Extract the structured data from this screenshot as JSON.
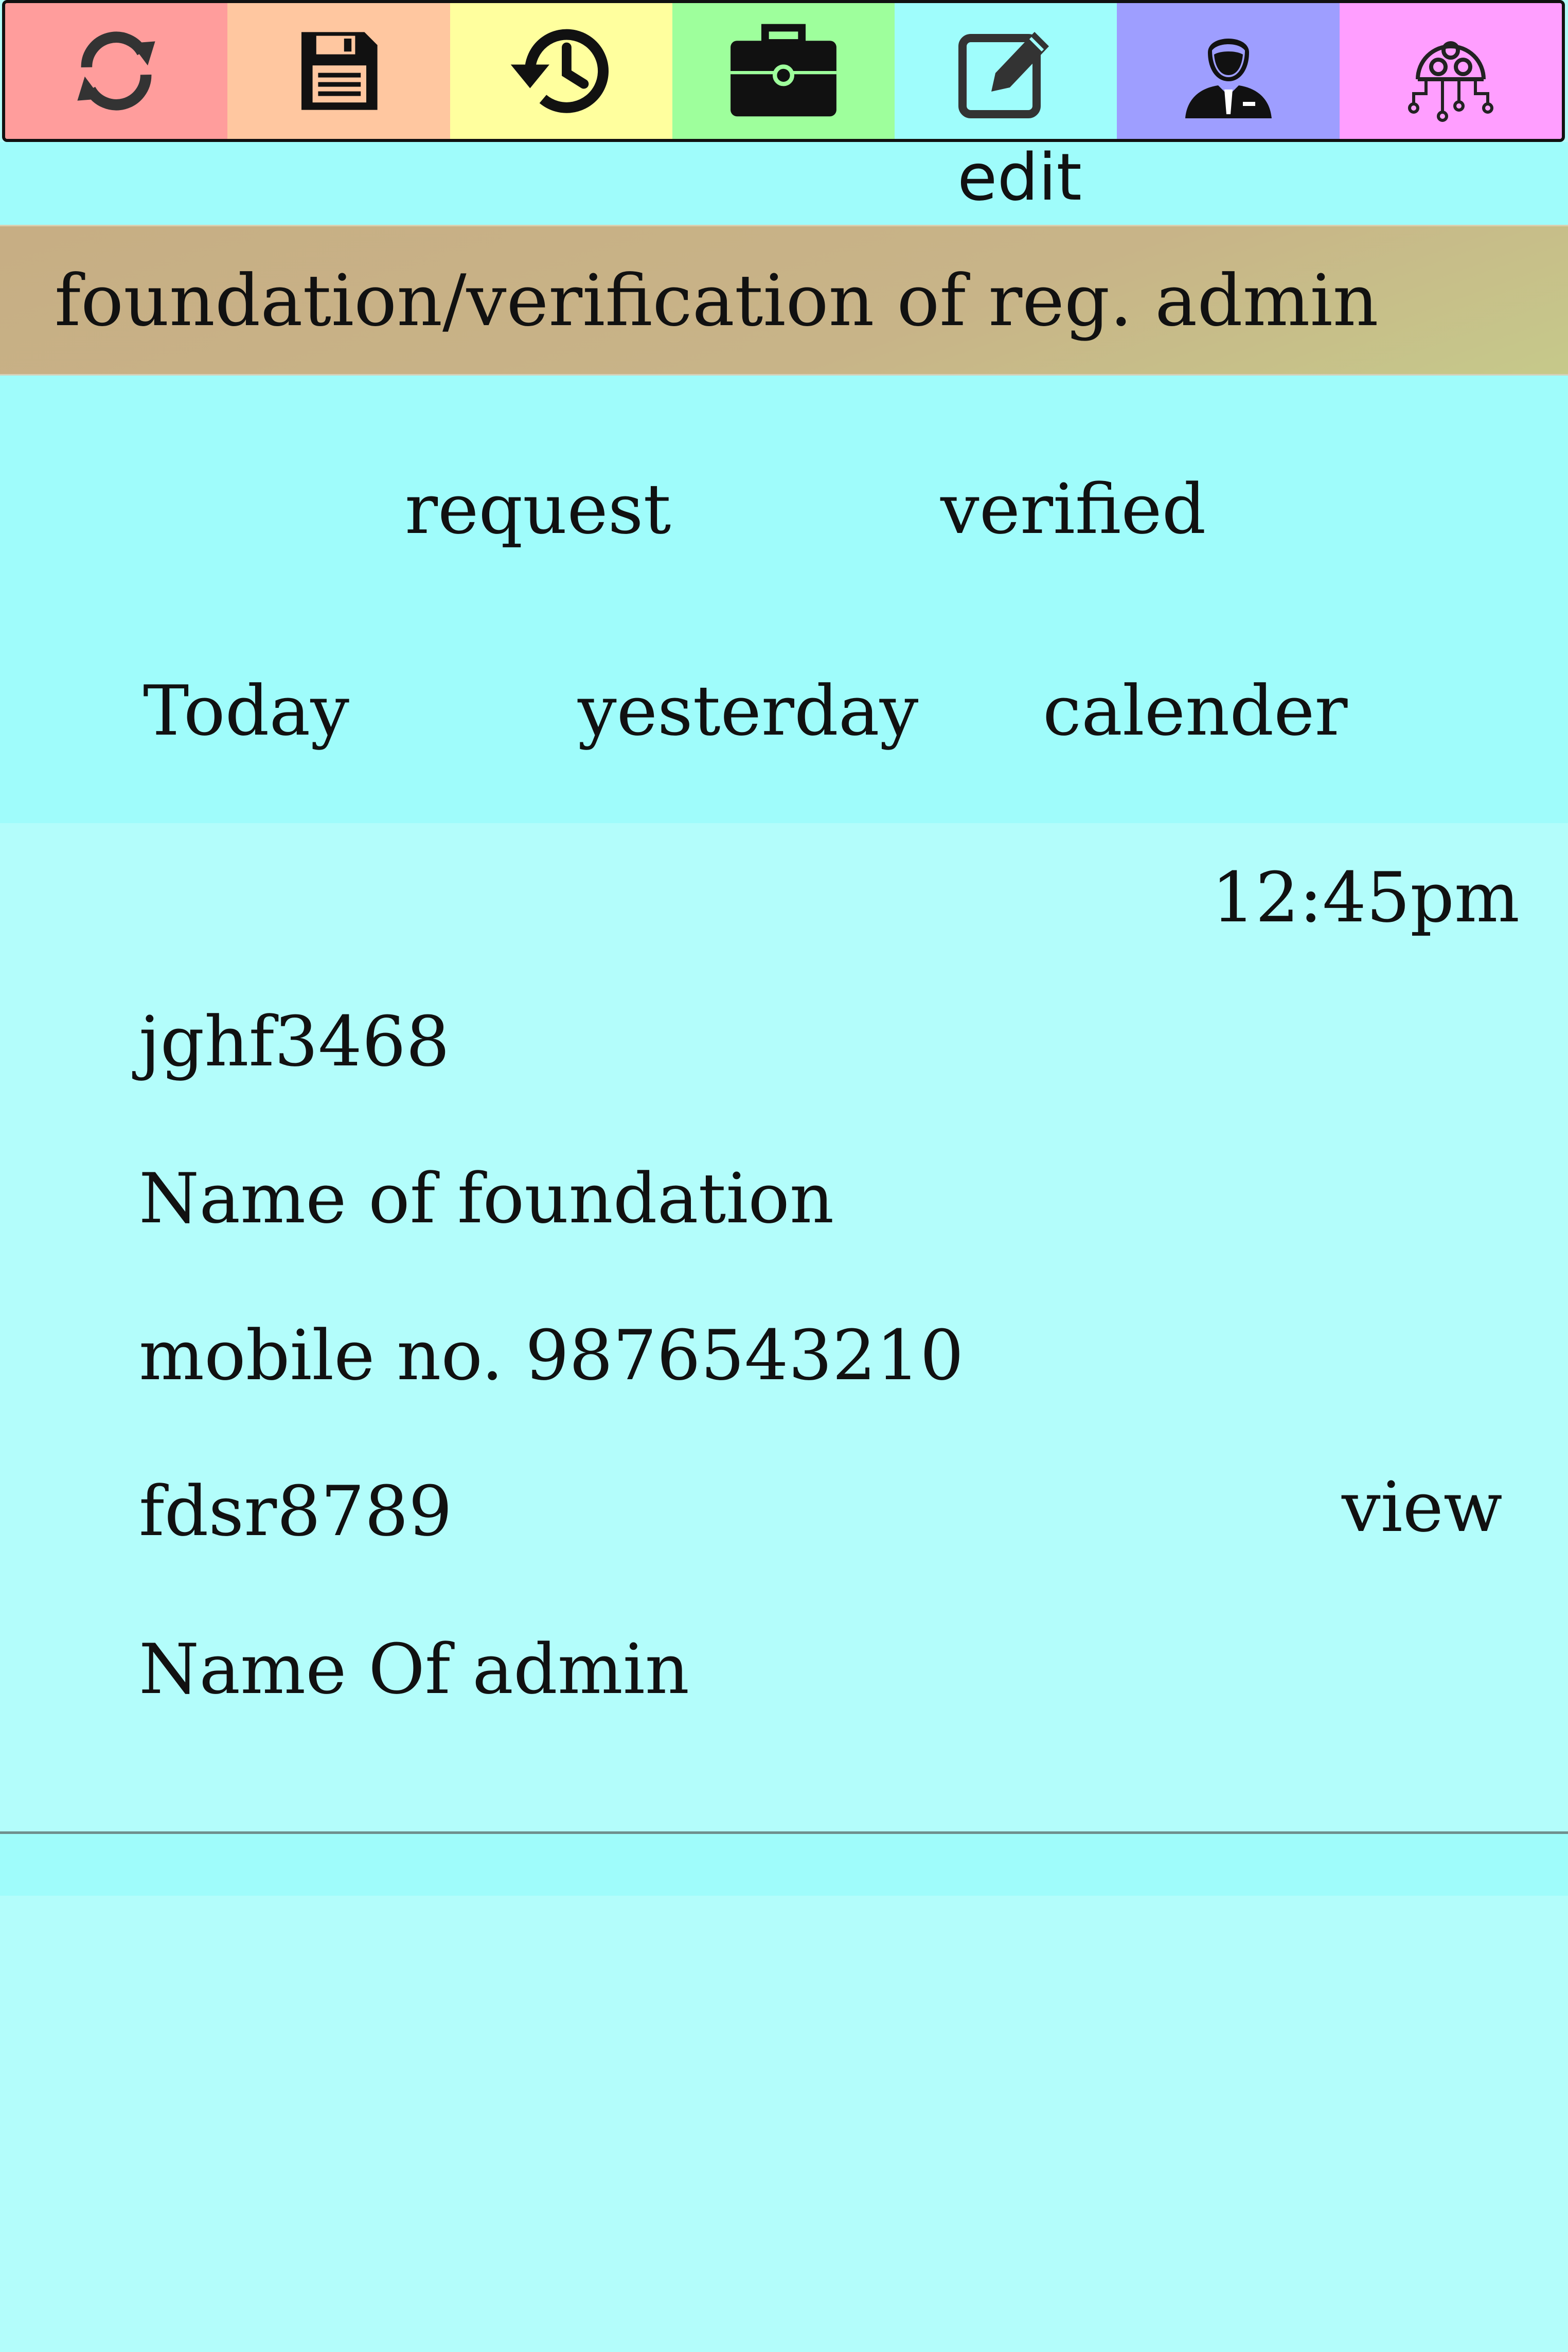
{
  "toolbar": {
    "items": [
      {
        "icon": "refresh-icon",
        "color": "#ff9d9c"
      },
      {
        "icon": "save-icon",
        "color": "#ffc7a0"
      },
      {
        "icon": "history-icon",
        "color": "#ffff9e"
      },
      {
        "icon": "briefcase-icon",
        "color": "#9eff9c"
      },
      {
        "icon": "edit-icon",
        "color": "#9ffdfc"
      },
      {
        "icon": "admin-user-icon",
        "color": "#9e9eff"
      },
      {
        "icon": "network-settings-icon",
        "color": "#ff9eff"
      }
    ],
    "active_label": "edit"
  },
  "header": {
    "title": "foundation/verification of reg. admin"
  },
  "tabs": {
    "request": "request",
    "verified": "verified"
  },
  "date_filters": {
    "today": "Today",
    "yesterday": "yesterday",
    "calendar": "calender"
  },
  "record": {
    "time": "12:45pm",
    "foundation_id": "jghf3468",
    "foundation_name": "Name of foundation",
    "mobile": "mobile no. 9876543210",
    "admin_id": "fdsr8789",
    "admin_name": "Name Of admin",
    "view_label": "view"
  },
  "colors": {
    "background": "#b3fdfb",
    "band": "#9ffcfb",
    "title_bar": "#c7b387"
  }
}
